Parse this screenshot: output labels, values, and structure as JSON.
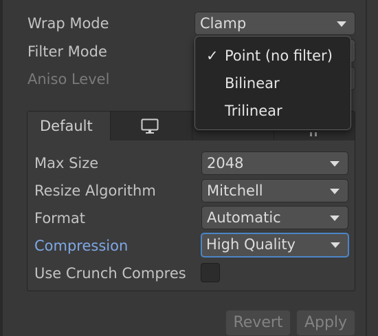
{
  "texture_settings": {
    "wrap_mode": {
      "label": "Wrap Mode",
      "value": "Clamp"
    },
    "filter_mode": {
      "label": "Filter Mode"
    },
    "aniso_level": {
      "label": "Aniso Level"
    }
  },
  "filter_mode_menu": {
    "options": [
      {
        "label": "Point (no filter)",
        "selected": true,
        "check": "✓"
      },
      {
        "label": "Bilinear",
        "selected": false,
        "check": ""
      },
      {
        "label": "Trilinear",
        "selected": false,
        "check": ""
      }
    ]
  },
  "platform_tabs": {
    "tabs": [
      {
        "label": "Default",
        "active": true
      },
      {
        "label": "",
        "icon": "monitor-icon",
        "active": false
      },
      {
        "label": "",
        "active": false
      },
      {
        "label": "",
        "active": false
      }
    ]
  },
  "platform_settings": {
    "max_size": {
      "label": "Max Size",
      "value": "2048"
    },
    "resize_algorithm": {
      "label": "Resize Algorithm",
      "value": "Mitchell"
    },
    "format": {
      "label": "Format",
      "value": "Automatic"
    },
    "compression": {
      "label": "Compression",
      "value": "High Quality"
    },
    "use_crunch": {
      "label": "Use Crunch Compres",
      "checked": false
    }
  },
  "footer": {
    "revert_label": "Revert",
    "apply_label": "Apply"
  },
  "colors": {
    "background": "#383838",
    "popup_background": "#262626",
    "focus_accent": "#4a86c8",
    "focused_label": "#7fa8e6"
  }
}
